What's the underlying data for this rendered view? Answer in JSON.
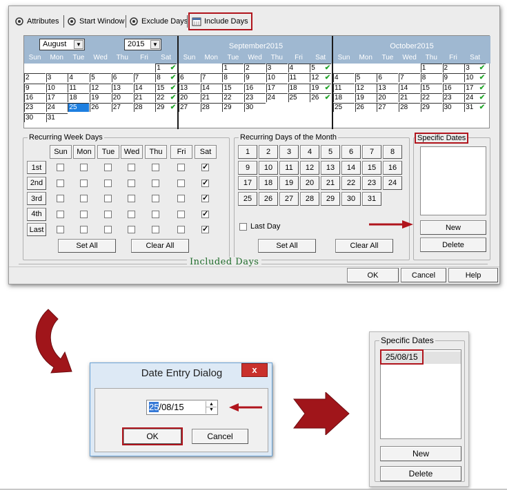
{
  "tabs": [
    {
      "label": "Attributes",
      "icon": "gear-icon"
    },
    {
      "label": "Start Window",
      "icon": "gear-icon"
    },
    {
      "label": "Exclude Days",
      "icon": "gear-icon"
    },
    {
      "label": "Include Days",
      "icon": "calendar-icon"
    }
  ],
  "calendar": {
    "months": [
      {
        "month_select": "August",
        "year_select": "2015"
      },
      {
        "title": "September2015"
      },
      {
        "title": "October2015"
      }
    ],
    "dow": [
      "Sun",
      "Mon",
      "Tue",
      "Wed",
      "Thu",
      "Fri",
      "Sat"
    ]
  },
  "week_group": {
    "legend": "Recurring Week Days",
    "days": [
      "Sun",
      "Mon",
      "Tue",
      "Wed",
      "Thu",
      "Fri",
      "Sat"
    ],
    "rows": [
      "1st",
      "2nd",
      "3rd",
      "4th",
      "Last"
    ],
    "set_all": "Set All",
    "clear_all": "Clear All"
  },
  "month_group": {
    "legend": "Recurring Days of the Month",
    "days": [
      "1",
      "2",
      "3",
      "4",
      "5",
      "6",
      "7",
      "8",
      "9",
      "10",
      "11",
      "12",
      "13",
      "14",
      "15",
      "16",
      "17",
      "18",
      "19",
      "20",
      "21",
      "22",
      "23",
      "24",
      "25",
      "26",
      "27",
      "28",
      "29",
      "30",
      "31"
    ],
    "last_day": "Last Day",
    "set_all": "Set All",
    "clear_all": "Clear All"
  },
  "specific": {
    "legend": "Specific Dates",
    "new": "New",
    "delete": "Delete"
  },
  "included_days_caption": "Included Days",
  "footer": {
    "ok": "OK",
    "cancel": "Cancel",
    "help": "Help"
  },
  "dialog": {
    "title": "Date Entry Dialog",
    "close": "x",
    "date_highlight": "25",
    "date_rest": "/08/15",
    "ok": "OK",
    "cancel": "Cancel"
  },
  "result_panel": {
    "legend": "Specific Dates",
    "entry": "25/08/15",
    "new": "New",
    "delete": "Delete"
  },
  "colors": {
    "highlight": "#b0141c",
    "calendar_header": "#9fb8d1",
    "selected_day": "#1e7fe0",
    "check": "#22a52a",
    "caption": "#1f6b2a"
  }
}
